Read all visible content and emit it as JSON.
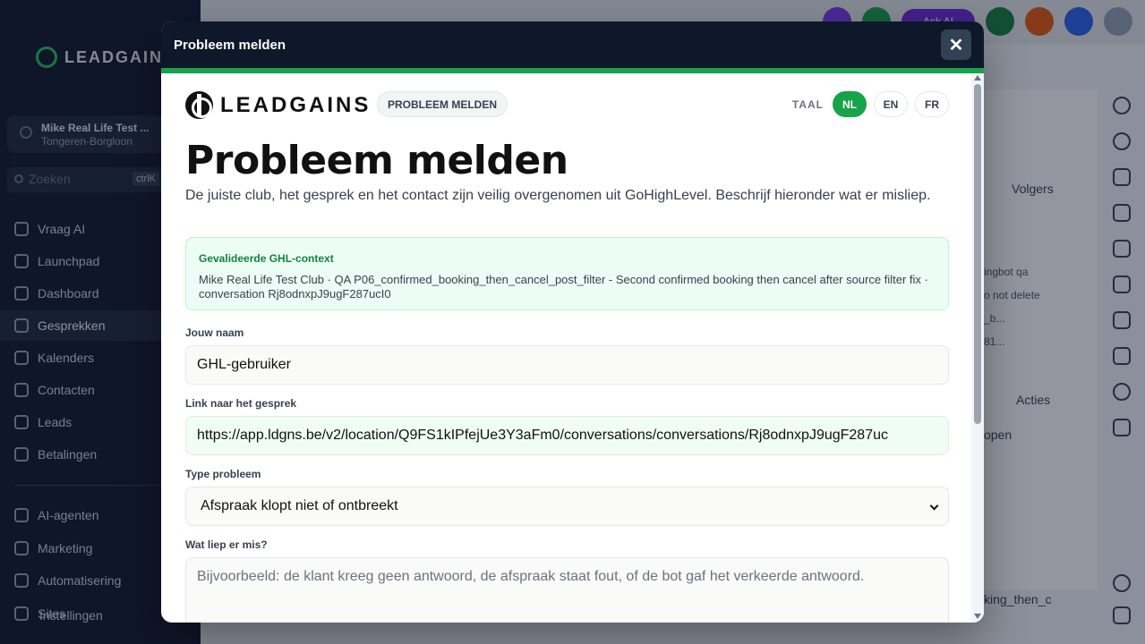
{
  "app": {
    "logo_text": "LEADGAINS",
    "location_name": "Mike Real Life Test ...",
    "location_sub": "Tongeren-Borgloon",
    "search_placeholder": "Zoeken",
    "search_shortcut": "ctrlK",
    "nav": [
      {
        "label": "Vraag AI",
        "icon": "sparkle-icon"
      },
      {
        "label": "Launchpad",
        "icon": "rocket-icon"
      },
      {
        "label": "Dashboard",
        "icon": "grid-icon"
      },
      {
        "label": "Gesprekken",
        "icon": "chat-icon"
      },
      {
        "label": "Kalenders",
        "icon": "calendar-icon"
      },
      {
        "label": "Contacten",
        "icon": "contacts-icon"
      },
      {
        "label": "Leads",
        "icon": "leads-icon"
      },
      {
        "label": "Betalingen",
        "icon": "payments-icon"
      },
      {
        "label": "AI-agenten",
        "icon": "ai-agent-icon"
      },
      {
        "label": "Marketing",
        "icon": "send-icon"
      },
      {
        "label": "Automatisering",
        "icon": "automation-icon"
      },
      {
        "label": "Sites",
        "icon": "globe-icon"
      },
      {
        "label": "Instellingen",
        "icon": "settings-icon"
      }
    ],
    "top_ask_label": "Ask AI",
    "right_panel": {
      "volgers": "Volgers",
      "acties": "Acties",
      "chip1": "ingbot qa",
      "chip2": "o not delete",
      "chip3": "_b...",
      "chip4": "81...",
      "row1": "open",
      "tail": "king_then_c"
    }
  },
  "modal": {
    "title": "Probleem melden",
    "close_label": "✕",
    "brand": "LEADGAINS",
    "badge": "PROBLEEM MELDEN",
    "lang_label": "TAAL",
    "languages": [
      {
        "code": "NL",
        "active": true
      },
      {
        "code": "EN",
        "active": false
      },
      {
        "code": "FR",
        "active": false
      }
    ],
    "heading": "Probleem melden",
    "intro": "De juiste club, het gesprek en het contact zijn veilig overgenomen uit GoHighLevel. Beschrijf hieronder wat er misliep.",
    "context": {
      "title": "Gevalideerde GHL-context",
      "text": "Mike Real Life Test Club · QA P06_confirmed_booking_then_cancel_post_filter - Second confirmed booking then cancel after source filter fix · conversation Rj8odnxpJ9ugF287ucI0"
    },
    "fields": {
      "name_label": "Jouw naam",
      "name_value": "GHL-gebruiker",
      "link_label": "Link naar het gesprek",
      "link_value": "https://app.ldgns.be/v2/location/Q9FS1kIPfejUe3Y3aFm0/conversations/conversations/Rj8odnxpJ9ugF287uc",
      "type_label": "Type probleem",
      "type_value": "Afspraak klopt niet of ontbreekt",
      "what_label": "Wat liep er mis?",
      "what_placeholder": "Bijvoorbeeld: de klant kreeg geen antwoord, de afspraak staat fout, of de bot gaf het verkeerde antwoord."
    }
  }
}
